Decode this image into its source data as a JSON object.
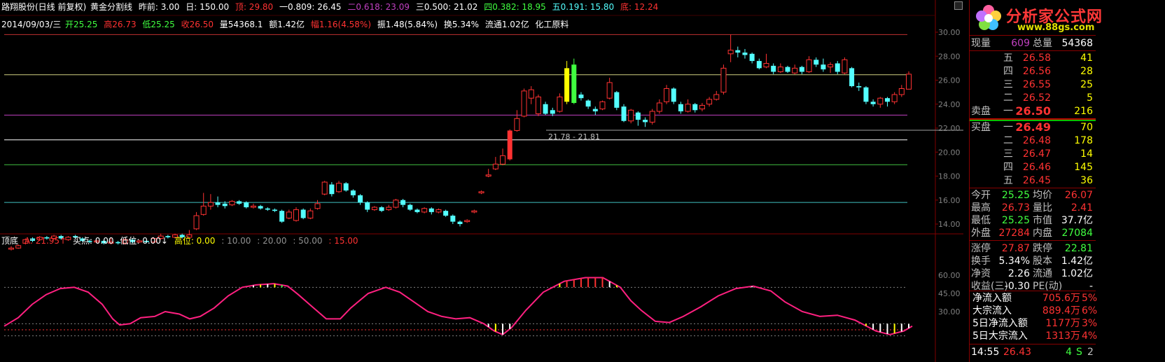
{
  "header": {
    "title": "路翔股份(日线 前复权)",
    "indicator": "黄金分割线",
    "prev_label": "昨前: 3.00",
    "day_label": "日: 150.00",
    "top_label": "顶: 29.80",
    "l1": "一0.809: 26.45",
    "l2": "二0.618: 23.09",
    "l3": "三0.500: 21.02",
    "l4": "四0.382: 18.95",
    "l5": "五0.191: 15.80",
    "bottom_label": "底: 12.24"
  },
  "info": {
    "date": "2014/09/03/三",
    "open": "开25.25",
    "high": "高26.73",
    "low": "低25.25",
    "close": "收26.50",
    "volume": "量54368.1",
    "amount": "额1.42亿",
    "change": "幅1.16(4.58%)",
    "amplitude": "振1.48(5.84%)",
    "turnover": "换5.34%",
    "float": "流通1.02亿",
    "sector": "化工原料"
  },
  "range_label": "21.78 - 21.81",
  "indicator_header": {
    "name": "顶底",
    "a": "A: 21.95↑",
    "buy": "买点: 0.00",
    "low": "低位: 0.00↓",
    "high": "高位: 0.00",
    "v10": ": 10.00",
    "v20": ": 20.00",
    "v50": ": 50.00",
    "v15": ": 15.00"
  },
  "price_axis": [
    "30.00",
    "28.00",
    "26.00",
    "24.00",
    "22.00",
    "20.00",
    "18.00",
    "16.00",
    "14.00"
  ],
  "ind_axis": [
    "60.00",
    "45.00",
    "30.00"
  ],
  "logo": {
    "text": "分析家公式网",
    "url": "www.88gs.com"
  },
  "quote": {
    "now_label": "现量",
    "now_val": "609",
    "total_label": "总量",
    "total_val": "54368",
    "asks": [
      {
        "label": "五",
        "price": "26.58",
        "vol": "41"
      },
      {
        "label": "四",
        "price": "26.56",
        "vol": "28"
      },
      {
        "label": "三",
        "price": "26.55",
        "vol": "25"
      },
      {
        "label": "二",
        "price": "26.52",
        "vol": "5"
      },
      {
        "label": "一",
        "price": "26.50",
        "vol": "216"
      }
    ],
    "sell_label": "卖盘",
    "buy_label": "买盘",
    "bids": [
      {
        "label": "一",
        "price": "26.49",
        "vol": "70"
      },
      {
        "label": "二",
        "price": "26.48",
        "vol": "178"
      },
      {
        "label": "三",
        "price": "26.47",
        "vol": "14"
      },
      {
        "label": "四",
        "price": "26.46",
        "vol": "145"
      },
      {
        "label": "五",
        "price": "26.45",
        "vol": "36"
      }
    ],
    "stats": [
      {
        "l1": "今开",
        "v1": "25.25",
        "l2": "均价",
        "v2": "26.07"
      },
      {
        "l1": "最高",
        "v1": "26.73",
        "l2": "量比",
        "v2": "2.41"
      },
      {
        "l1": "最低",
        "v1": "25.25",
        "l2": "市值",
        "v2": "37.7亿"
      },
      {
        "l1": "外盘",
        "v1": "27284",
        "l2": "内盘",
        "v2": "27084"
      },
      {
        "l1": "涨停",
        "v1": "27.87",
        "l2": "跌停",
        "v2": "22.81"
      },
      {
        "l1": "换手",
        "v1": "5.34%",
        "l2": "股本",
        "v2": "1.42亿"
      },
      {
        "l1": "净资",
        "v1": "2.26",
        "l2": "流通",
        "v2": "1.02亿"
      },
      {
        "l1": "收益(三)",
        "v1": "-0.30",
        "l2": "PE(动)",
        "v2": "-"
      }
    ],
    "flows": [
      {
        "label": "净流入额",
        "val": "705.6万",
        "pct": "5%"
      },
      {
        "label": "大宗流入",
        "val": "889.4万",
        "pct": "6%"
      },
      {
        "label": "5日净流入额",
        "val": "1177万",
        "pct": "3%"
      },
      {
        "label": "5日大宗流入",
        "val": "1313万",
        "pct": "4%"
      }
    ],
    "tick": {
      "time": "14:55",
      "price": "26.43",
      "vol": "4",
      "side": "S",
      "count": "2"
    }
  },
  "colors": {
    "up": "#ff3232",
    "down": "#54ffff",
    "text": "#c0c0c0",
    "purple": "#c040c0",
    "grid": "#800000",
    "yellow": "#e0e000",
    "green": "#40ff40"
  }
}
